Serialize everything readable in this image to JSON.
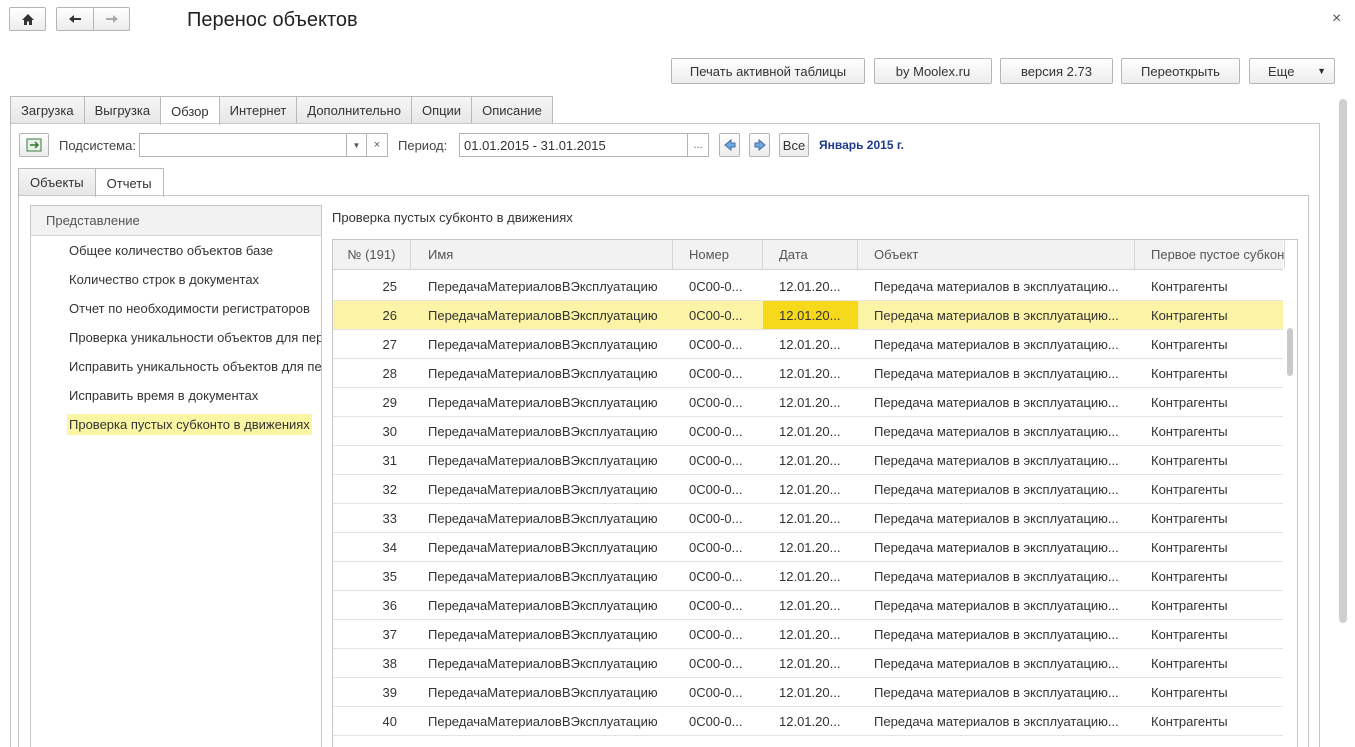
{
  "window": {
    "title": "Перенос объектов",
    "close_glyph": "×"
  },
  "nav": {
    "home_icon": "home-icon",
    "back_icon": "arrow-left-icon",
    "forward_icon": "arrow-right-icon"
  },
  "toolbar": {
    "print": "Печать активной таблицы",
    "moolex": "by Moolex.ru",
    "version": "версия 2.73",
    "reopen": "Переоткрыть",
    "more": "Еще"
  },
  "tabs": [
    "Загрузка",
    "Выгрузка",
    "Обзор",
    "Интернет",
    "Дополнительно",
    "Опции",
    "Описание"
  ],
  "active_tab": "Обзор",
  "filter": {
    "subsystem_label": "Подсистема:",
    "subsystem_value": "",
    "period_label": "Период:",
    "period_value": "01.01.2015 - 31.01.2015",
    "period_button": "...",
    "all_button": "Все",
    "period_caption": "Январь 2015 г."
  },
  "subtabs": [
    "Объекты",
    "Отчеты"
  ],
  "active_subtab": "Отчеты",
  "left_list": {
    "header": "Представление",
    "items": [
      "Общее количество объектов базе",
      "Количество строк в документах",
      "Отчет по необходимости регистраторов",
      "Проверка уникальности объектов для переноса",
      "Исправить уникальность объектов для переноса",
      "Исправить время в документах",
      "Проверка пустых субконто в движениях"
    ],
    "selected_index": 6
  },
  "report": {
    "title": "Проверка пустых субконто в движениях",
    "columns": [
      "№ (191)",
      "Имя",
      "Номер",
      "Дата",
      "Объект",
      "Первое пустое субконто"
    ],
    "rows": [
      [
        "25",
        "ПередачаМатериаловВЭксплуатацию",
        "0С00-0...",
        "12.01.20...",
        "Передача материалов в эксплуатацию...",
        "Контрагенты"
      ],
      [
        "26",
        "ПередачаМатериаловВЭксплуатацию",
        "0С00-0...",
        "12.01.20...",
        "Передача материалов в эксплуатацию...",
        "Контрагенты"
      ],
      [
        "27",
        "ПередачаМатериаловВЭксплуатацию",
        "0С00-0...",
        "12.01.20...",
        "Передача материалов в эксплуатацию...",
        "Контрагенты"
      ],
      [
        "28",
        "ПередачаМатериаловВЭксплуатацию",
        "0С00-0...",
        "12.01.20...",
        "Передача материалов в эксплуатацию...",
        "Контрагенты"
      ],
      [
        "29",
        "ПередачаМатериаловВЭксплуатацию",
        "0С00-0...",
        "12.01.20...",
        "Передача материалов в эксплуатацию...",
        "Контрагенты"
      ],
      [
        "30",
        "ПередачаМатериаловВЭксплуатацию",
        "0С00-0...",
        "12.01.20...",
        "Передача материалов в эксплуатацию...",
        "Контрагенты"
      ],
      [
        "31",
        "ПередачаМатериаловВЭксплуатацию",
        "0С00-0...",
        "12.01.20...",
        "Передача материалов в эксплуатацию...",
        "Контрагенты"
      ],
      [
        "32",
        "ПередачаМатериаловВЭксплуатацию",
        "0С00-0...",
        "12.01.20...",
        "Передача материалов в эксплуатацию...",
        "Контрагенты"
      ],
      [
        "33",
        "ПередачаМатериаловВЭксплуатацию",
        "0С00-0...",
        "12.01.20...",
        "Передача материалов в эксплуатацию...",
        "Контрагенты"
      ],
      [
        "34",
        "ПередачаМатериаловВЭксплуатацию",
        "0С00-0...",
        "12.01.20...",
        "Передача материалов в эксплуатацию...",
        "Контрагенты"
      ],
      [
        "35",
        "ПередачаМатериаловВЭксплуатацию",
        "0С00-0...",
        "12.01.20...",
        "Передача материалов в эксплуатацию...",
        "Контрагенты"
      ],
      [
        "36",
        "ПередачаМатериаловВЭксплуатацию",
        "0С00-0...",
        "12.01.20...",
        "Передача материалов в эксплуатацию...",
        "Контрагенты"
      ],
      [
        "37",
        "ПередачаМатериаловВЭксплуатацию",
        "0С00-0...",
        "12.01.20...",
        "Передача материалов в эксплуатацию...",
        "Контрагенты"
      ],
      [
        "38",
        "ПередачаМатериаловВЭксплуатацию",
        "0С00-0...",
        "12.01.20...",
        "Передача материалов в эксплуатацию...",
        "Контрагенты"
      ],
      [
        "39",
        "ПередачаМатериаловВЭксплуатацию",
        "0С00-0...",
        "12.01.20...",
        "Передача материалов в эксплуатацию...",
        "Контрагенты"
      ],
      [
        "40",
        "ПередачаМатериаловВЭксплуатацию",
        "0С00-0...",
        "12.01.20...",
        "Передача материалов в эксплуатацию...",
        "Контрагенты"
      ]
    ],
    "selected_row": 1,
    "current_cell_column": 3
  },
  "colors": {
    "selection": "#fbf4a6",
    "current_cell": "#f6d91a",
    "caption": "#1f3a8a"
  }
}
